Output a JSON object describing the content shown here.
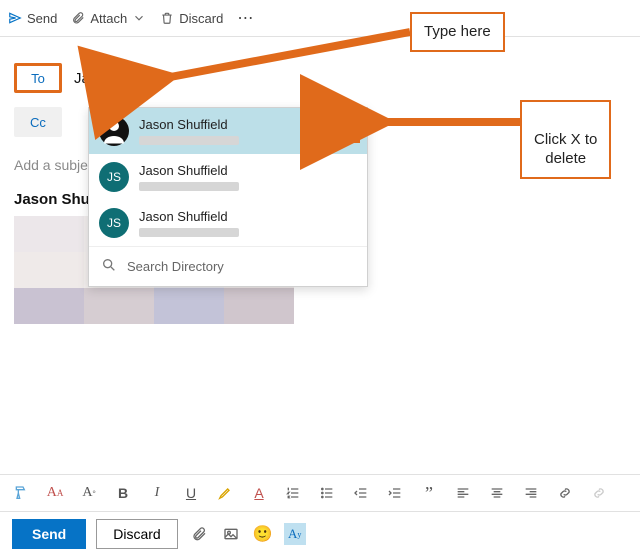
{
  "toolbar": {
    "send": "Send",
    "attach": "Attach",
    "discard": "Discard",
    "more": "⋯"
  },
  "compose": {
    "to_label": "To",
    "cc_label": "Cc",
    "to_value": "Jason",
    "subject_placeholder": "Add a subject",
    "body_preview_name": "Jason Shuffield"
  },
  "suggestions": {
    "items": [
      {
        "name": "Jason Shuffield",
        "initials": "",
        "avatar_variant": "dark",
        "selected": true
      },
      {
        "name": "Jason Shuffield",
        "initials": "JS",
        "avatar_variant": "teal",
        "selected": false
      },
      {
        "name": "Jason Shuffield",
        "initials": "JS",
        "avatar_variant": "teal",
        "selected": false
      }
    ],
    "search_directory": "Search Directory"
  },
  "actions": {
    "send": "Send",
    "discard": "Discard"
  },
  "callouts": {
    "type_here": "Type here",
    "click_x": "Click X to\ndelete"
  },
  "colors": {
    "accent": "#0673c6",
    "highlight_border": "#e06a1b",
    "teal": "#0f6e74"
  }
}
